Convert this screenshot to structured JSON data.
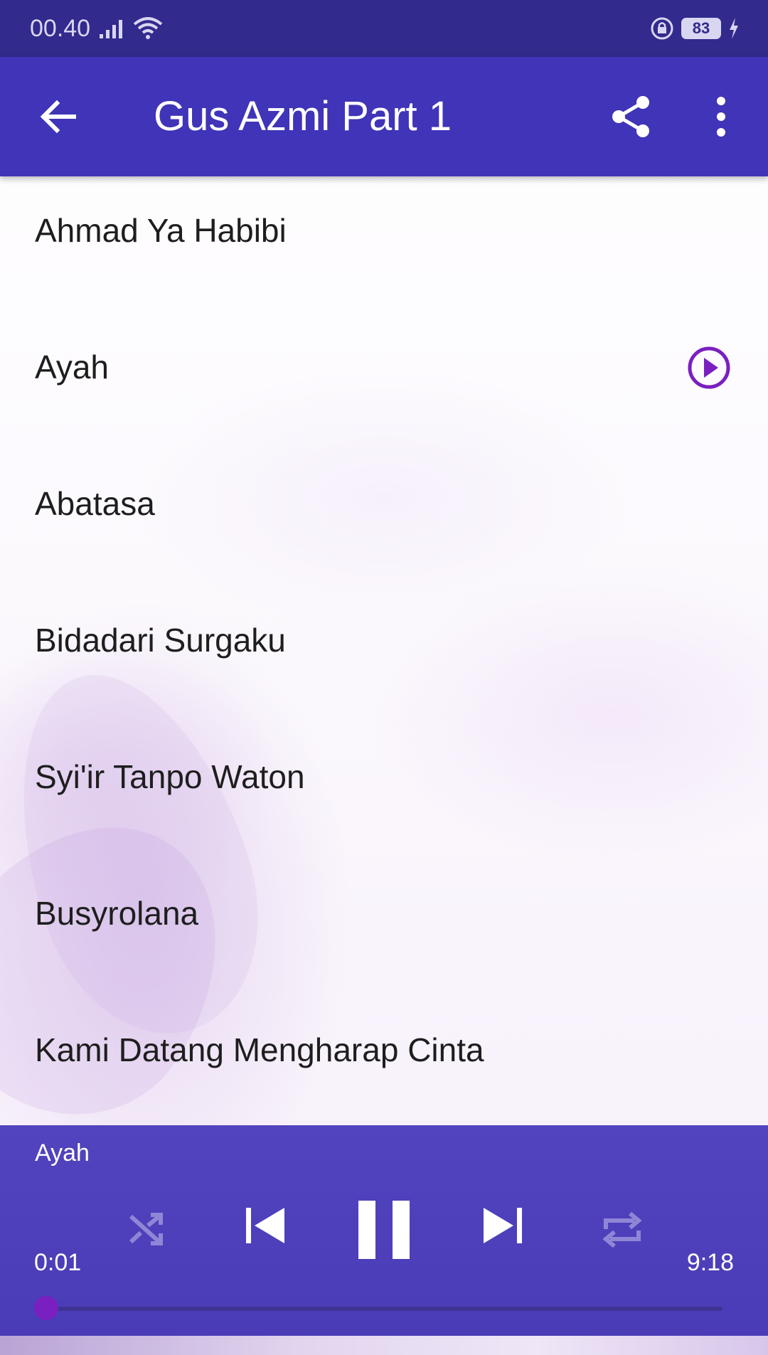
{
  "status_bar": {
    "time": "00.40",
    "battery": "83",
    "icons": [
      "signal-icon",
      "wifi-icon",
      "lock-rotation-icon",
      "battery-icon",
      "charging-icon"
    ]
  },
  "app_bar": {
    "title": "Gus Azmi Part 1",
    "icons": [
      "back-arrow-icon",
      "share-icon",
      "more-vertical-icon"
    ]
  },
  "songs": [
    {
      "title": "Ahmad Ya Habibi",
      "playing": false
    },
    {
      "title": "Ayah",
      "playing": true
    },
    {
      "title": "Abatasa",
      "playing": false
    },
    {
      "title": "Bidadari Surgaku",
      "playing": false
    },
    {
      "title": "Syi'ir Tanpo Waton",
      "playing": false
    },
    {
      "title": "Busyrolana",
      "playing": false
    },
    {
      "title": "Kami Datang Mengharap Cinta",
      "playing": false
    }
  ],
  "player": {
    "now_playing": "Ayah",
    "current_time": "0:01",
    "total_time": "9:18",
    "progress_fraction": 0.002,
    "controls": [
      "shuffle-icon",
      "previous-icon",
      "pause-icon",
      "next-icon",
      "repeat-icon"
    ]
  },
  "colors": {
    "status_bar": "#322a8c",
    "app_bar": "#4034b8",
    "player": "#4d40ba",
    "accent": "#7a1fc0"
  }
}
